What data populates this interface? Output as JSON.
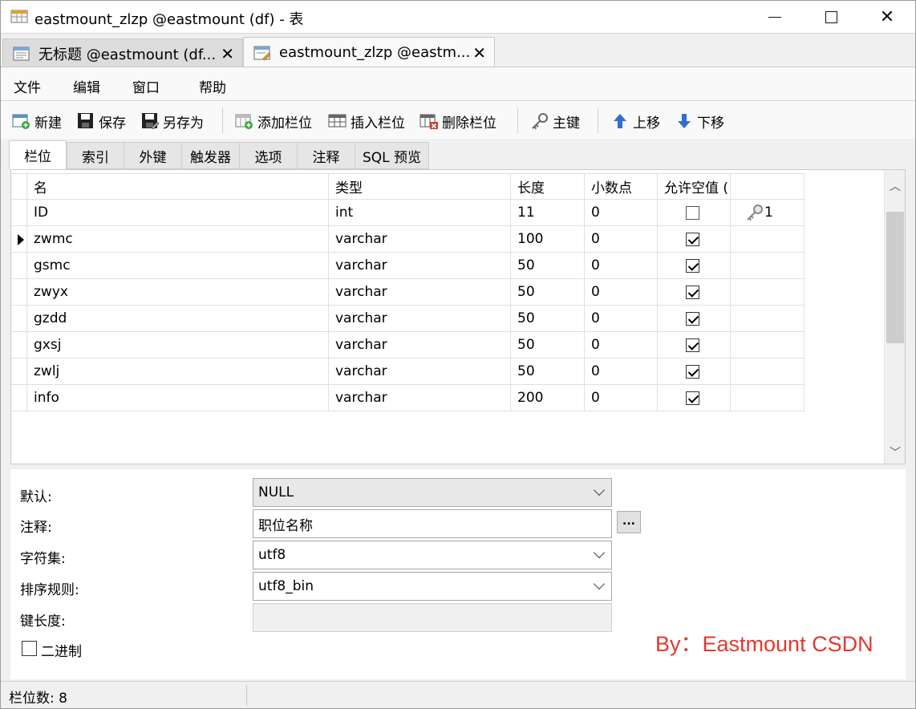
{
  "window": {
    "title": "eastmount_zlzp @eastmount (df) - 表"
  },
  "doc_tabs": [
    {
      "label": "无标题 @eastmount (df...",
      "close": "✕"
    },
    {
      "label": "eastmount_zlzp @eastm...",
      "close": "✕"
    }
  ],
  "menu": [
    "文件",
    "编辑",
    "窗口",
    "帮助"
  ],
  "toolbar": {
    "new": "新建",
    "save": "保存",
    "save_as": "另存为",
    "add_field": "添加栏位",
    "insert_field": "插入栏位",
    "delete_field": "删除栏位",
    "primary_key": "主键",
    "move_up": "上移",
    "move_down": "下移"
  },
  "sub_tabs": [
    "栏位",
    "索引",
    "外键",
    "触发器",
    "选项",
    "注释",
    "SQL 预览"
  ],
  "grid": {
    "columns": [
      "名",
      "类型",
      "长度",
      "小数点",
      "允许空值 (",
      ""
    ],
    "rows": [
      {
        "name": "ID",
        "type": "int",
        "length": "11",
        "decimals": "0",
        "nullable": false,
        "key": "1",
        "current": false
      },
      {
        "name": "zwmc",
        "type": "varchar",
        "length": "100",
        "decimals": "0",
        "nullable": true,
        "key": "",
        "current": true
      },
      {
        "name": "gsmc",
        "type": "varchar",
        "length": "50",
        "decimals": "0",
        "nullable": true,
        "key": "",
        "current": false
      },
      {
        "name": "zwyx",
        "type": "varchar",
        "length": "50",
        "decimals": "0",
        "nullable": true,
        "key": "",
        "current": false
      },
      {
        "name": "gzdd",
        "type": "varchar",
        "length": "50",
        "decimals": "0",
        "nullable": true,
        "key": "",
        "current": false
      },
      {
        "name": "gxsj",
        "type": "varchar",
        "length": "50",
        "decimals": "0",
        "nullable": true,
        "key": "",
        "current": false
      },
      {
        "name": "zwlj",
        "type": "varchar",
        "length": "50",
        "decimals": "0",
        "nullable": true,
        "key": "",
        "current": false
      },
      {
        "name": "info",
        "type": "varchar",
        "length": "200",
        "decimals": "0",
        "nullable": true,
        "key": "",
        "current": false
      }
    ]
  },
  "properties": {
    "default_label": "默认:",
    "default_value": "NULL",
    "comment_label": "注释:",
    "comment_value": "职位名称",
    "comment_btn": "...",
    "charset_label": "字符集:",
    "charset_value": "utf8",
    "collation_label": "排序规则:",
    "collation_value": "utf8_bin",
    "key_length_label": "键长度:",
    "key_length_value": "",
    "binary_label": "二进制",
    "binary_checked": false
  },
  "watermark": "By：Eastmount CSDN",
  "status": {
    "field_count": "栏位数: 8"
  }
}
